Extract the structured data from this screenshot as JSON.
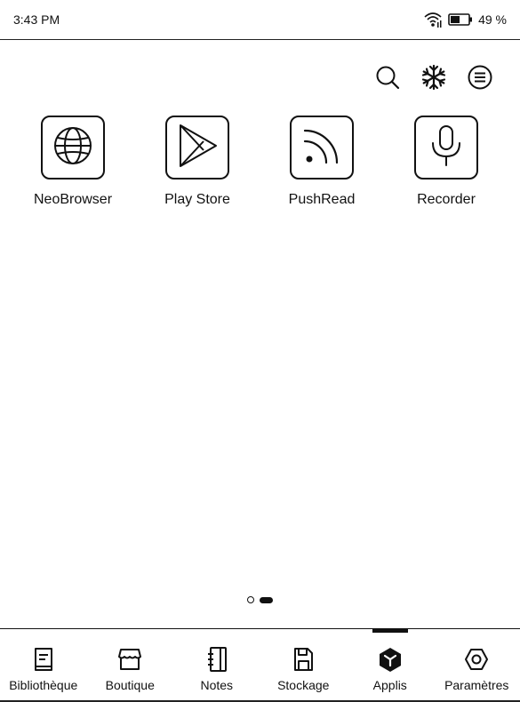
{
  "status_bar": {
    "time": "3:43 PM",
    "wifi_icon": "wifi-icon",
    "battery_icon": "battery-icon",
    "battery_percent": "49 %"
  },
  "toolbar": {
    "search_icon": "search-icon",
    "freeze_icon": "snowflake-icon",
    "menu_icon": "menu-icon"
  },
  "apps": [
    {
      "label": "NeoBrowser",
      "icon": "globe-icon"
    },
    {
      "label": "Play Store",
      "icon": "play-store-icon"
    },
    {
      "label": "PushRead",
      "icon": "rss-icon"
    },
    {
      "label": "Recorder",
      "icon": "microphone-icon"
    }
  ],
  "pager": {
    "pages": 2,
    "current": 2
  },
  "bottom_nav": {
    "items": [
      {
        "label": "Bibliothèque",
        "icon": "library-icon",
        "active": false
      },
      {
        "label": "Boutique",
        "icon": "store-icon",
        "active": false
      },
      {
        "label": "Notes",
        "icon": "notebook-icon",
        "active": false
      },
      {
        "label": "Stockage",
        "icon": "save-icon",
        "active": false
      },
      {
        "label": "Applis",
        "icon": "apps-icon",
        "active": true
      },
      {
        "label": "Paramètres",
        "icon": "settings-icon",
        "active": false
      }
    ]
  }
}
